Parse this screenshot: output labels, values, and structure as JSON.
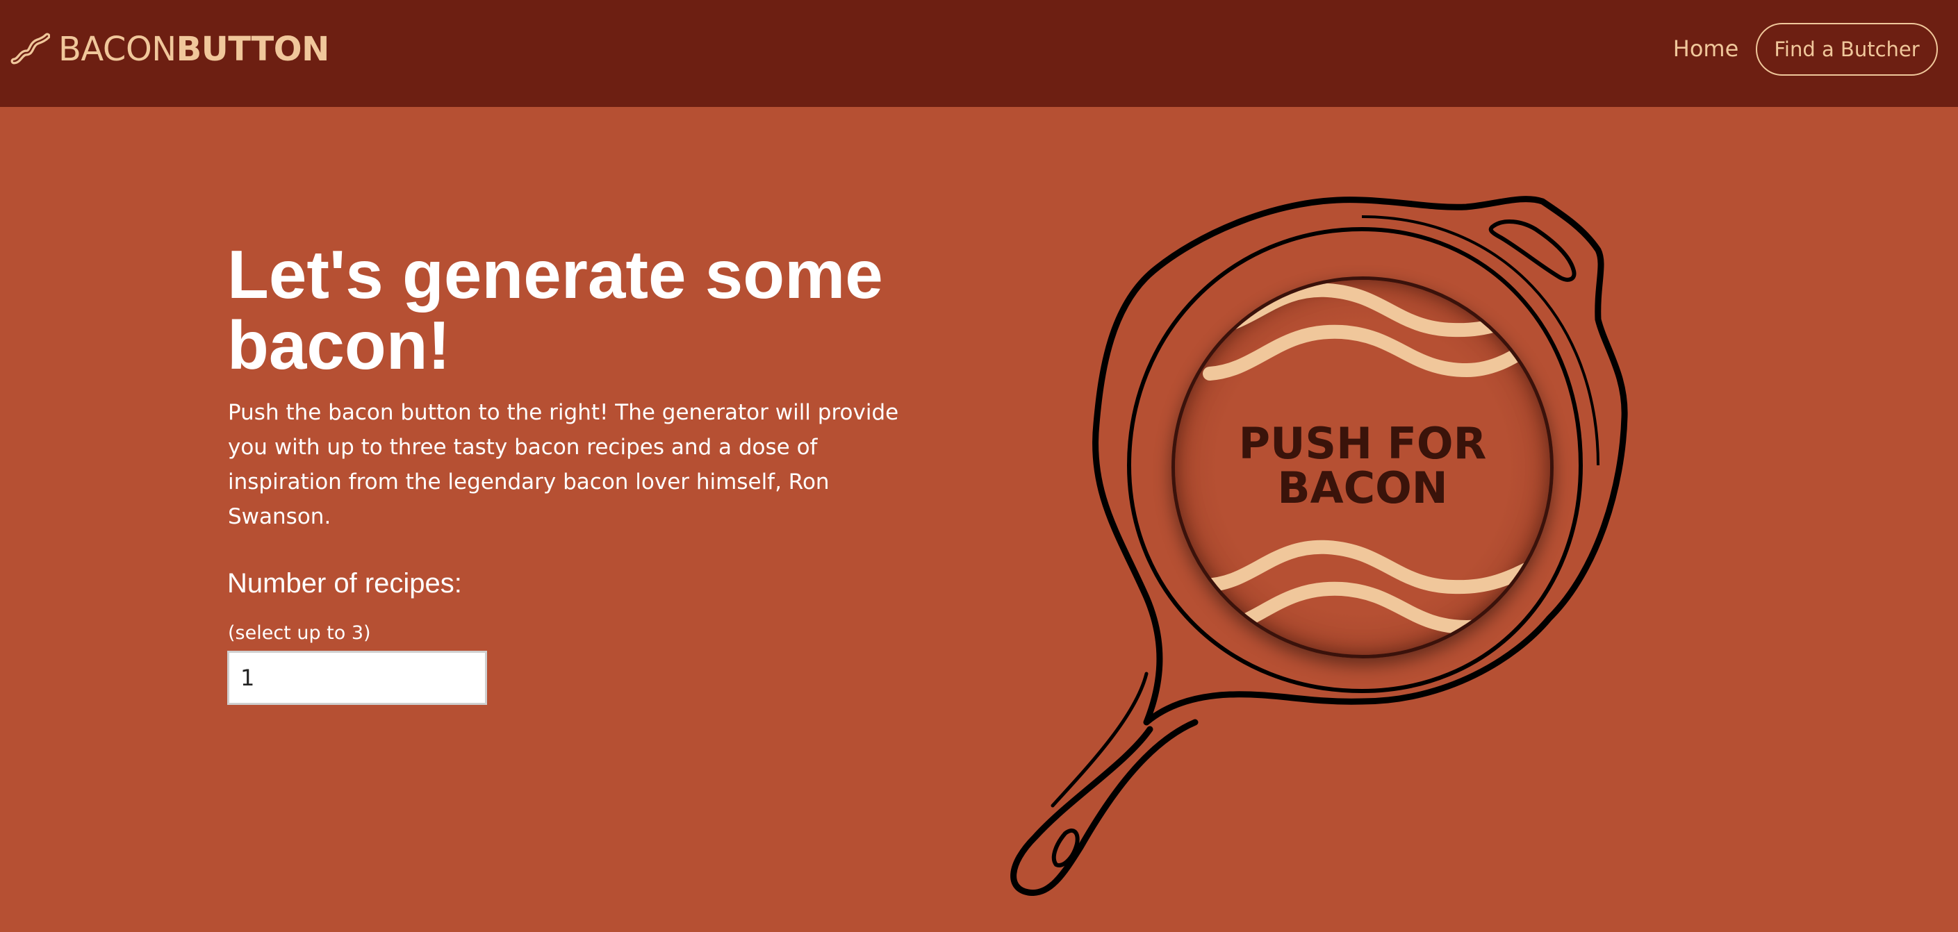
{
  "navbar": {
    "brand_light": "BACON",
    "brand_bold": "BUTTON",
    "home_label": "Home",
    "butcher_label": "Find a Butcher"
  },
  "hero": {
    "headline": "Let's generate some bacon!",
    "intro": "Push the bacon button to the right! The generator will provide you with up to three tasty bacon recipes and a dose of inspiration from the legendary bacon lover himself, Ron Swanson.",
    "recipes_label": "Number of recipes:",
    "recipes_hint": "(select up to 3)",
    "recipes_value": "1"
  },
  "bacon_button": {
    "label": "PUSH FOR\nBACON"
  },
  "colors": {
    "navbar_bg": "#6d1f12",
    "page_bg": "#b65033",
    "accent_cream": "#f0c79b",
    "button_text": "#3a130a"
  },
  "icons": {
    "brand": "bacon-strip-icon",
    "illustration": "cast-iron-skillet"
  }
}
